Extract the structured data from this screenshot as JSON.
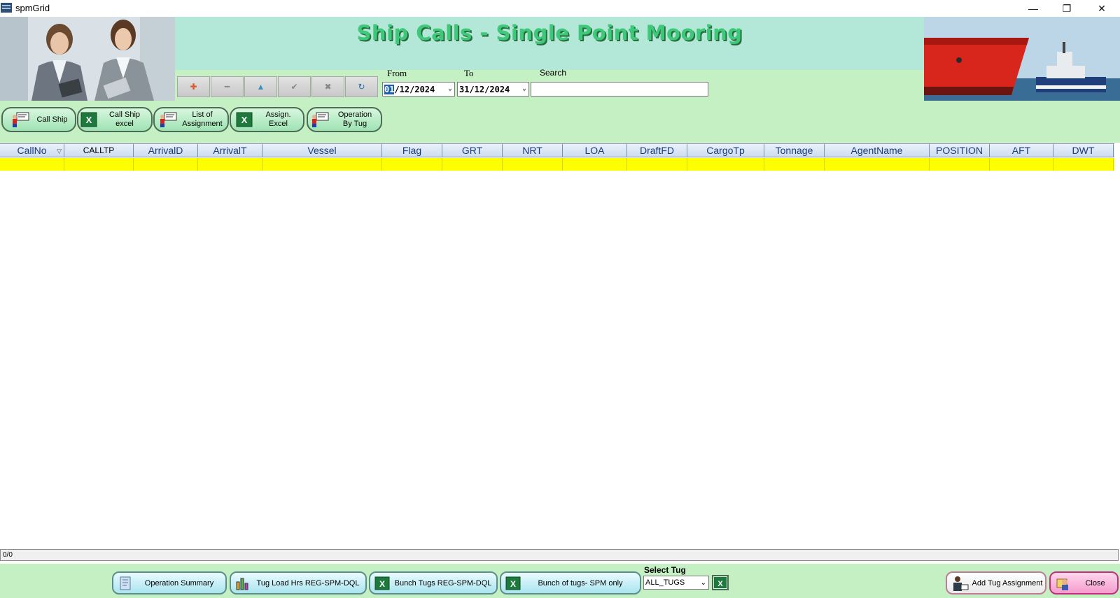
{
  "window": {
    "title": "spmGrid",
    "controls": {
      "minimize": "—",
      "restore": "❐",
      "close": "✕"
    }
  },
  "header": {
    "title": "Ship Calls - Single Point Mooring",
    "nav_buttons": [
      {
        "icon": "plus-icon",
        "glyph": "✚"
      },
      {
        "icon": "minus-icon",
        "glyph": "━"
      },
      {
        "icon": "up-triangle-icon",
        "glyph": "▲"
      },
      {
        "icon": "check-icon",
        "glyph": "✔"
      },
      {
        "icon": "cancel-icon",
        "glyph": "✖"
      },
      {
        "icon": "refresh-icon",
        "glyph": "↻"
      }
    ],
    "from": {
      "label": "From",
      "value_selected": "01",
      "value_rest": "/12/2024"
    },
    "to": {
      "label": "To",
      "value": "31/12/2024"
    },
    "search": {
      "label": "Search",
      "value": "",
      "placeholder": ""
    }
  },
  "toolbar": {
    "call_ship": "Call Ship",
    "call_ship_excel": "Call Ship excel",
    "list_of_assignment": "List of Assignment",
    "assign_excel": "Assign. Excel",
    "operation_by_tug": "Operation By Tug"
  },
  "grid": {
    "columns": [
      "CallNo",
      "CALLTP",
      "ArrivalD",
      "ArrivalT",
      "Vessel",
      "Flag",
      "GRT",
      "NRT",
      "LOA",
      "DraftFD",
      "CargoTp",
      "Tonnage",
      "AgentName",
      "POSITION",
      "AFT",
      "DWT"
    ],
    "rows": [
      [
        "",
        "",
        "",
        "",
        "",
        "",
        "",
        "",
        "",
        "",
        "",
        "",
        "",
        "",
        "",
        ""
      ]
    ],
    "record_counter": "0/0",
    "row_highlight_color": "#ffff00"
  },
  "bottom": {
    "operation_summary": "Operation Summary",
    "tug_load_hrs": "Tug Load Hrs REG-SPM-DQL",
    "bunch_tugs": "Bunch Tugs REG-SPM-DQL",
    "bunch_of_tugs_spm": "Bunch of tugs- SPM only",
    "select_tug_label": "Select Tug",
    "select_tug_value": "ALL_TUGS",
    "add_tug_assignment": "Add Tug Assignment",
    "close": "Close"
  },
  "colors": {
    "header_band": "#b3e8d8",
    "control_band": "#c4f0c4",
    "title_text": "#3ec87a",
    "grid_header_text": "#1a3a7a"
  }
}
